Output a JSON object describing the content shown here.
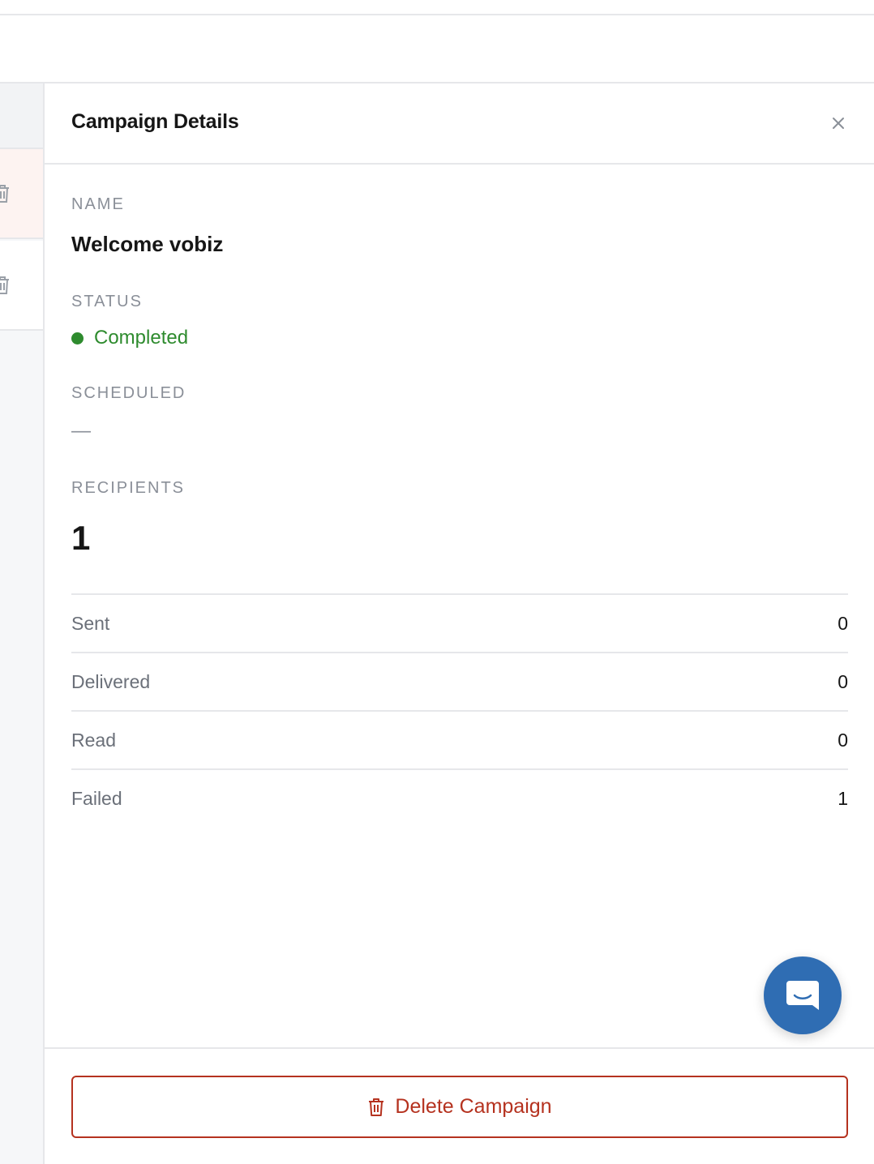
{
  "drawer": {
    "title": "Campaign Details",
    "close_symbol": "×"
  },
  "fields": {
    "name_label": "NAME",
    "name_value": "Welcome vobiz",
    "status_label": "STATUS",
    "status_value": "Completed",
    "scheduled_label": "SCHEDULED",
    "scheduled_value": "—",
    "recipients_label": "RECIPIENTS",
    "recipients_value": "1"
  },
  "stats": [
    {
      "label": "Sent",
      "value": "0"
    },
    {
      "label": "Delivered",
      "value": "0"
    },
    {
      "label": "Read",
      "value": "0"
    },
    {
      "label": "Failed",
      "value": "1"
    }
  ],
  "footer": {
    "delete_label": "Delete Campaign"
  },
  "icons": {
    "close": "close-icon",
    "trash": "trash-icon",
    "chat": "chat-icon",
    "status_dot": "status-dot-icon"
  },
  "colors": {
    "status_completed": "#2e8b2e",
    "danger": "#b5321f",
    "chat_fab": "#2f6db3"
  }
}
